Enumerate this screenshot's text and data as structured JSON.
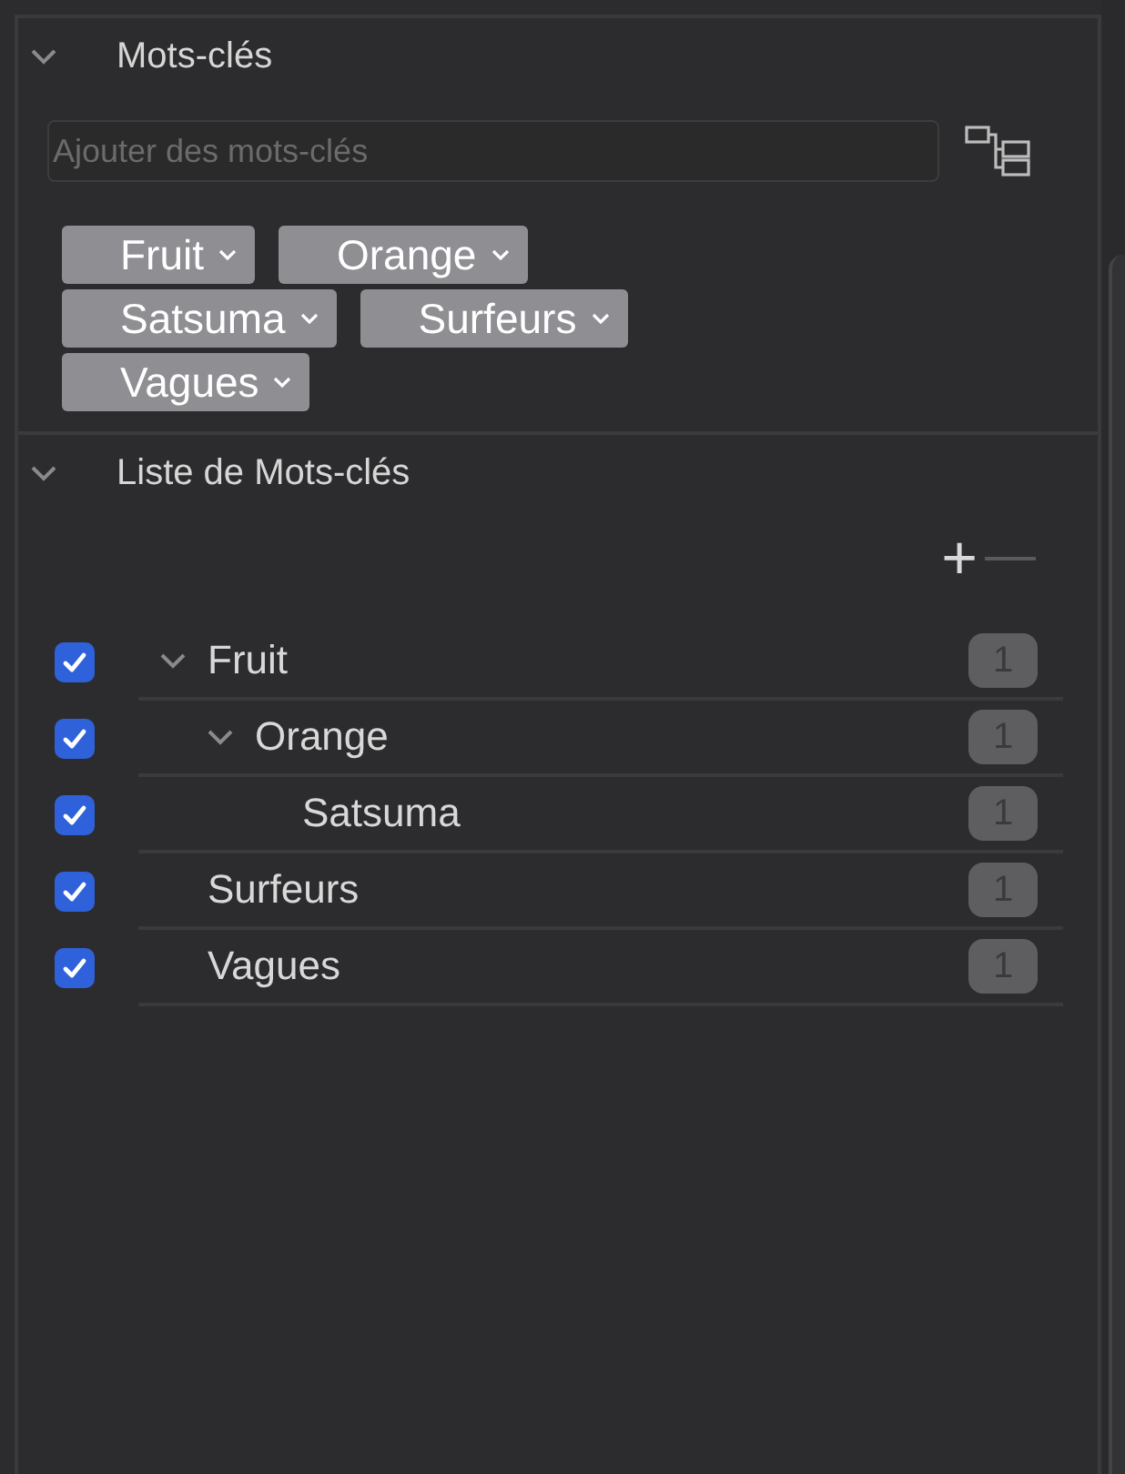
{
  "keywords_section": {
    "title": "Mots-clés",
    "expanded": true,
    "search": {
      "placeholder": "Ajouter des mots-clés"
    },
    "tokens": [
      {
        "label": "Fruit"
      },
      {
        "label": "Orange"
      },
      {
        "label": "Satsuma"
      },
      {
        "label": "Surfeurs"
      },
      {
        "label": "Vagues"
      }
    ]
  },
  "keyword_list": {
    "title": "Liste de Mots-clés",
    "expanded": true,
    "add_button": "+",
    "remove_disabled": true,
    "items": [
      {
        "label": "Fruit",
        "checked": true,
        "count": "1",
        "expanded": true,
        "children": [
          {
            "label": "Orange",
            "checked": true,
            "count": "1",
            "expanded": true,
            "children": [
              {
                "label": "Satsuma",
                "checked": true,
                "count": "1"
              }
            ]
          }
        ]
      },
      {
        "label": "Surfeurs",
        "checked": true,
        "count": "1"
      },
      {
        "label": "Vagues",
        "checked": true,
        "count": "1"
      }
    ]
  }
}
